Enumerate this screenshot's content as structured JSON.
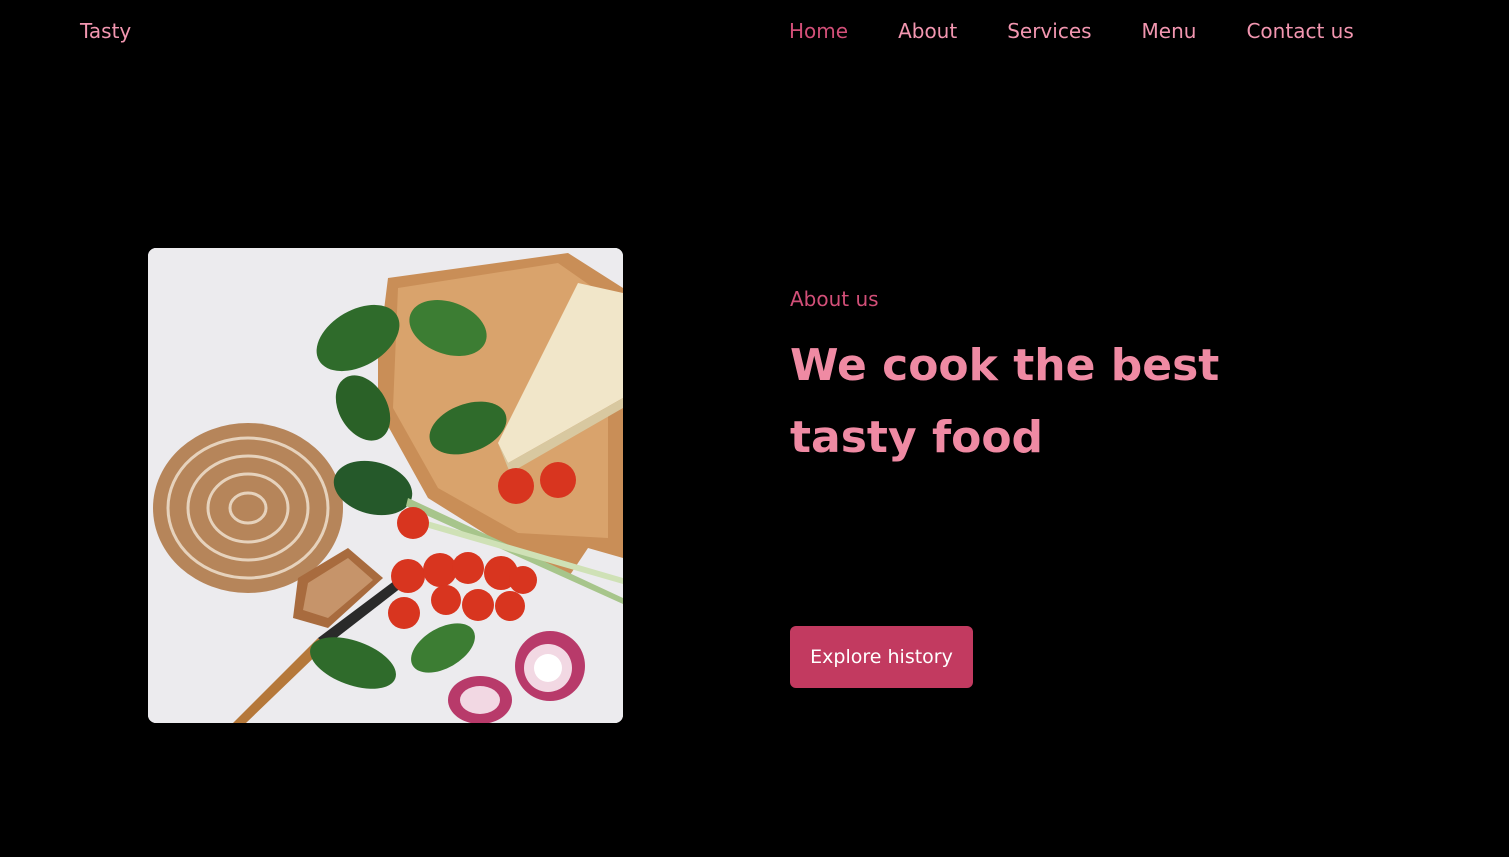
{
  "header": {
    "brand": "Tasty",
    "nav": [
      {
        "label": "Home",
        "active": true
      },
      {
        "label": "About",
        "active": false
      },
      {
        "label": "Services",
        "active": false
      },
      {
        "label": "Menu",
        "active": false
      },
      {
        "label": "Contact us",
        "active": false
      }
    ]
  },
  "hero": {
    "eyebrow": "About us",
    "headline_line1": "We cook the best",
    "headline_line2": "tasty food",
    "cta_label": "Explore history",
    "image_icon": "food-flatlay-photo"
  },
  "colors": {
    "background": "#000000",
    "accent": "#c23a60",
    "nav_text": "#f296b0",
    "nav_active": "#d24f78",
    "headline": "#ef8aa3"
  }
}
